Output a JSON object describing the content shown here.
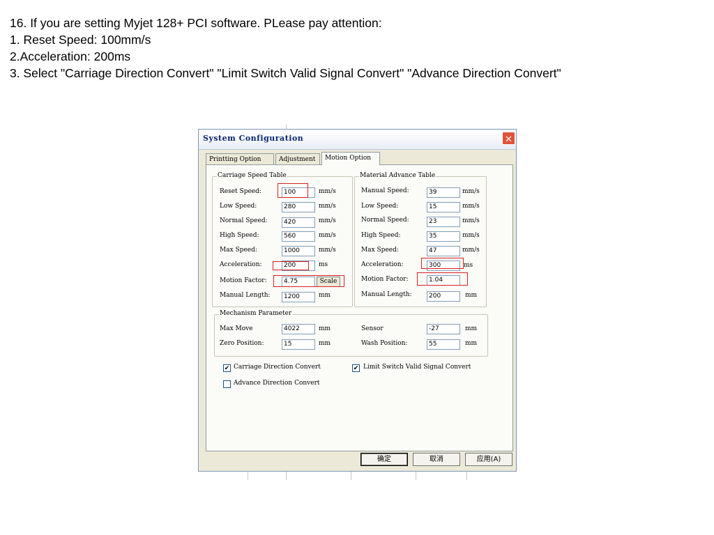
{
  "instructions": {
    "line1": "16. If you are setting Myjet 128+ PCI software. PLease pay attention:",
    "line2": "1. Reset Speed: 100mm/s",
    "line3": "2.Acceleration: 200ms",
    "line4": "3. Select \"Carriage Direction Convert\" \"Limit Switch Valid Signal Convert\" \"Advance Direction Convert\""
  },
  "dialog": {
    "title": "System Configuration",
    "close_symbol": "✕",
    "close_icon": "close-icon",
    "tabs": [
      {
        "label": "Printting Option"
      },
      {
        "label": "Adjustment"
      },
      {
        "label": "Motion Option"
      }
    ],
    "active_tab": "Motion Option",
    "carriage": {
      "title": "Carriage Speed Table",
      "reset_speed": {
        "label": "Reset Speed:",
        "value": "100",
        "unit": "mm/s"
      },
      "low_speed": {
        "label": "Low Speed:",
        "value": "280",
        "unit": "mm/s"
      },
      "normal_speed": {
        "label": "Normal Speed:",
        "value": "420",
        "unit": "mm/s"
      },
      "high_speed": {
        "label": "High Speed:",
        "value": "560",
        "unit": "mm/s"
      },
      "max_speed": {
        "label": "Max Speed:",
        "value": "1000",
        "unit": "mm/s"
      },
      "acceleration": {
        "label": "Acceleration:",
        "value": "200",
        "unit": "ms"
      },
      "motion_factor": {
        "label": "Motion Factor:",
        "value": "4.75",
        "button": "Scale"
      },
      "manual_length": {
        "label": "Manual Length:",
        "value": "1200",
        "unit": "mm"
      }
    },
    "material": {
      "title": "Material Advance Table",
      "manual_speed": {
        "label": "Manual Speed:",
        "value": "39",
        "unit": "mm/s"
      },
      "low_speed": {
        "label": "Low Speed:",
        "value": "15",
        "unit": "mm/s"
      },
      "normal_speed": {
        "label": "Normal Speed:",
        "value": "23",
        "unit": "mm/s"
      },
      "high_speed": {
        "label": "High Speed:",
        "value": "35",
        "unit": "mm/s"
      },
      "max_speed": {
        "label": "Max Speed:",
        "value": "47",
        "unit": "mm/s"
      },
      "acceleration": {
        "label": "Acceleration:",
        "value": "300",
        "unit": "ms"
      },
      "motion_factor": {
        "label": "Motion Factor:",
        "value": "1.04"
      },
      "manual_length": {
        "label": "Manual Length:",
        "value": "200",
        "unit": "mm"
      }
    },
    "mechanism": {
      "title": "Mechanism Parameter",
      "max_move": {
        "label": "Max Move",
        "value": "4022",
        "unit": "mm"
      },
      "zero_position": {
        "label": "Zero Position:",
        "value": "15",
        "unit": "mm"
      },
      "sensor": {
        "label": "Sensor",
        "value": "-27",
        "unit": "mm"
      },
      "wash_position": {
        "label": "Wash Position:",
        "value": "55",
        "unit": "mm"
      }
    },
    "checks": {
      "carriage_direction": {
        "label": "Carriage Direction Convert",
        "checked": true
      },
      "limit_switch": {
        "label": "Limit Switch Valid Signal Convert",
        "checked": true
      },
      "advance_direction": {
        "label": "Advance Direction Convert",
        "checked": false
      },
      "check_mark": "✔"
    },
    "buttons": {
      "ok": "确定",
      "cancel": "取消",
      "apply": "应用(A)"
    },
    "highlight_color": "#d62020"
  }
}
